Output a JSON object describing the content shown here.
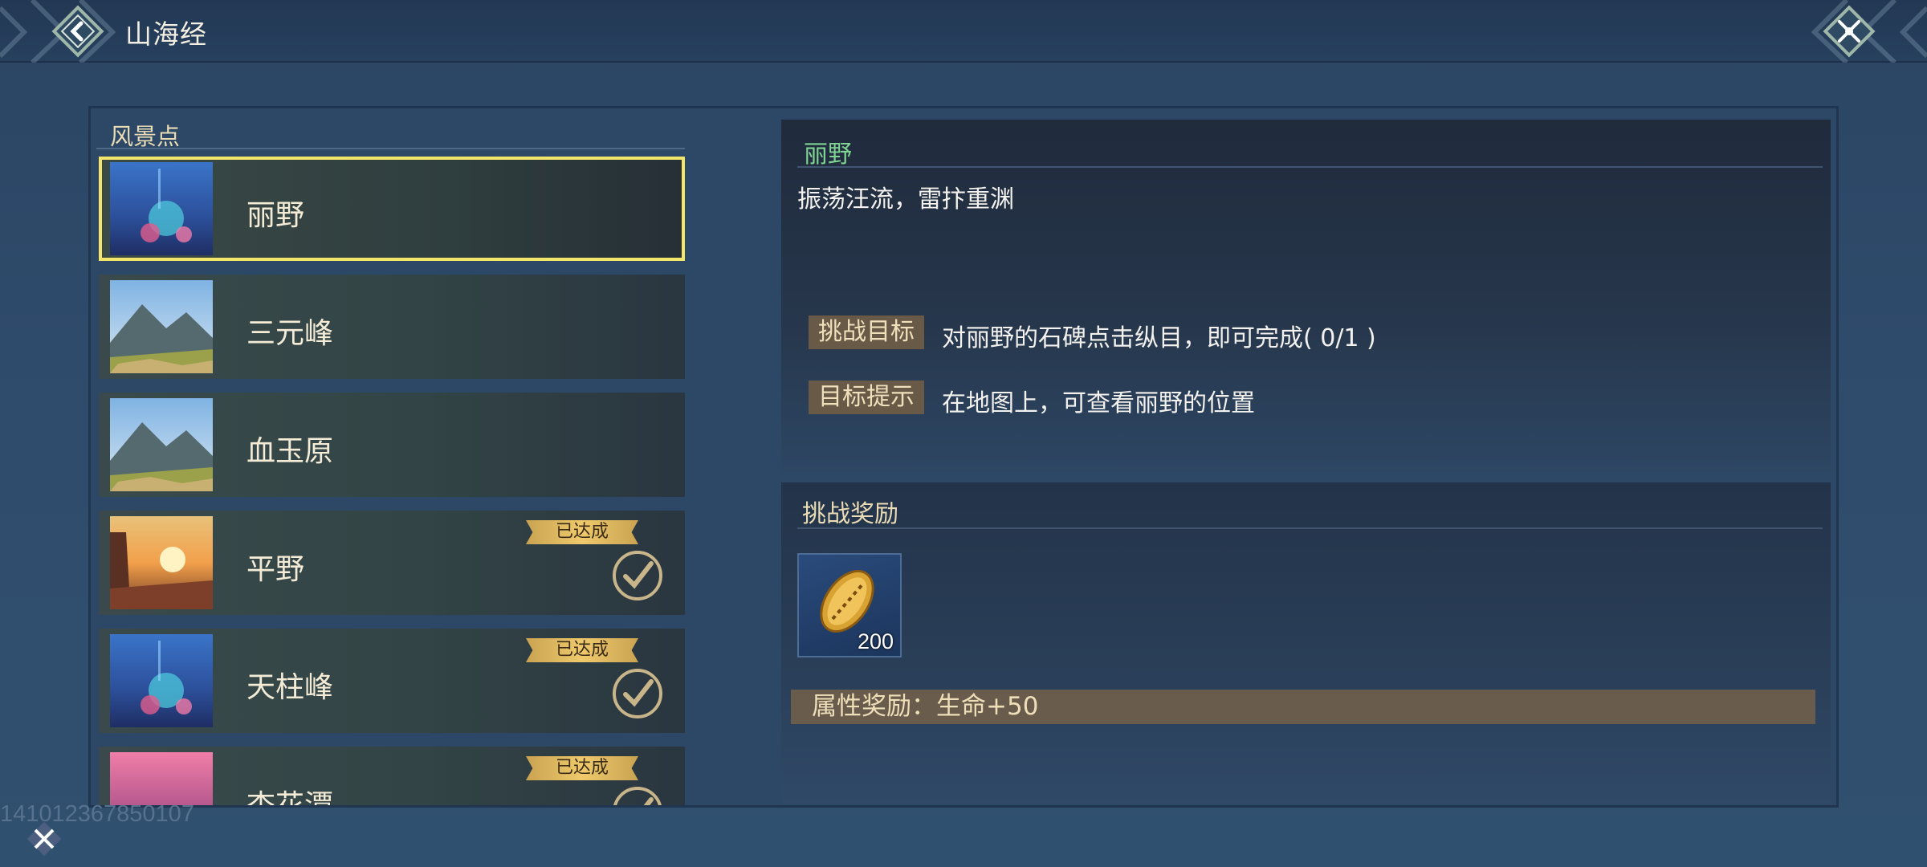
{
  "header": {
    "title": "山海经"
  },
  "list": {
    "section_title": "风景点",
    "items": [
      {
        "name": "丽野",
        "selected": true,
        "completed": false,
        "thumb": "blue-night"
      },
      {
        "name": "三元峰",
        "selected": false,
        "completed": false,
        "thumb": "mountain"
      },
      {
        "name": "血玉原",
        "selected": false,
        "completed": false,
        "thumb": "mountain"
      },
      {
        "name": "平野",
        "selected": false,
        "completed": true,
        "badge": "已达成",
        "thumb": "sunset"
      },
      {
        "name": "天柱峰",
        "selected": false,
        "completed": true,
        "badge": "已达成",
        "thumb": "blue-night"
      },
      {
        "name": "杏花潭",
        "selected": false,
        "completed": true,
        "badge": "已达成",
        "thumb": "pink"
      }
    ]
  },
  "detail": {
    "name": "丽野",
    "description": "振荡汪流，雷抃重渊",
    "goal_tag": "挑战目标",
    "goal_text": "对丽野的石碑点击纵目，即可完成( 0/1 )",
    "hint_tag": "目标提示",
    "hint_text": "在地图上，可查看丽野的位置"
  },
  "rewards": {
    "title": "挑战奖励",
    "item_icon": "golden-shell-icon",
    "item_count": "200",
    "attribute": "属性奖励：生命+50"
  },
  "footer": {
    "id_text": "141012367850107"
  },
  "colors": {
    "selected_outline": "#f3e46a",
    "place_name": "#7fd393",
    "badge_gold": "#efc96b"
  }
}
